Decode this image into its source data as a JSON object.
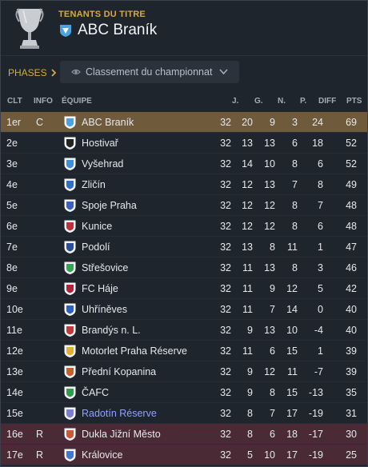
{
  "title_holder": {
    "label": "TENANTS DU TITRE",
    "team": "ABC Braník"
  },
  "toolbar": {
    "phases_label": "PHASES",
    "dropdown_value": "Classement du championnat"
  },
  "table": {
    "headers": {
      "pos": "CLT",
      "info": "INFO",
      "team": "ÉQUIPE",
      "played": "J.",
      "won": "G.",
      "drawn": "N.",
      "lost": "P.",
      "diff": "DIFF",
      "pts": "PTS"
    },
    "rows": [
      {
        "pos": "1er",
        "info": "C",
        "team": "ABC Braník",
        "played": "32",
        "won": "20",
        "drawn": "9",
        "lost": "3",
        "diff": "24",
        "pts": "69",
        "crest_color": "#4aa3e0",
        "status": "champion"
      },
      {
        "pos": "2e",
        "info": "",
        "team": "Hostivař",
        "played": "32",
        "won": "13",
        "drawn": "13",
        "lost": "6",
        "diff": "18",
        "pts": "52",
        "crest_color": "#222222",
        "status": ""
      },
      {
        "pos": "3e",
        "info": "",
        "team": "Vyšehrad",
        "played": "32",
        "won": "14",
        "drawn": "10",
        "lost": "8",
        "diff": "6",
        "pts": "52",
        "crest_color": "#3c8fd8",
        "status": ""
      },
      {
        "pos": "4e",
        "info": "",
        "team": "Zličín",
        "played": "32",
        "won": "12",
        "drawn": "13",
        "lost": "7",
        "diff": "8",
        "pts": "49",
        "crest_color": "#2d6fd0",
        "status": ""
      },
      {
        "pos": "5e",
        "info": "",
        "team": "Spoje Praha",
        "played": "32",
        "won": "12",
        "drawn": "12",
        "lost": "8",
        "diff": "7",
        "pts": "48",
        "crest_color": "#3b5fc4",
        "status": ""
      },
      {
        "pos": "6e",
        "info": "",
        "team": "Kunice",
        "played": "32",
        "won": "12",
        "drawn": "12",
        "lost": "8",
        "diff": "6",
        "pts": "48",
        "crest_color": "#c2303a",
        "status": ""
      },
      {
        "pos": "7e",
        "info": "",
        "team": "Podolí",
        "played": "32",
        "won": "13",
        "drawn": "8",
        "lost": "11",
        "diff": "1",
        "pts": "47",
        "crest_color": "#2a4f9c",
        "status": ""
      },
      {
        "pos": "8e",
        "info": "",
        "team": "Střešovice",
        "played": "32",
        "won": "11",
        "drawn": "13",
        "lost": "8",
        "diff": "3",
        "pts": "46",
        "crest_color": "#2fa84f",
        "status": ""
      },
      {
        "pos": "9e",
        "info": "",
        "team": "FC Háje",
        "played": "32",
        "won": "11",
        "drawn": "9",
        "lost": "12",
        "diff": "5",
        "pts": "42",
        "crest_color": "#b0243a",
        "status": ""
      },
      {
        "pos": "10e",
        "info": "",
        "team": "Uhříněves",
        "played": "32",
        "won": "11",
        "drawn": "7",
        "lost": "14",
        "diff": "0",
        "pts": "40",
        "crest_color": "#2c62c4",
        "status": ""
      },
      {
        "pos": "11e",
        "info": "",
        "team": "Brandýs n. L.",
        "played": "32",
        "won": "9",
        "drawn": "13",
        "lost": "10",
        "diff": "-4",
        "pts": "40",
        "crest_color": "#c23a3a",
        "status": ""
      },
      {
        "pos": "12e",
        "info": "",
        "team": "Motorlet Praha Réserve",
        "played": "32",
        "won": "11",
        "drawn": "6",
        "lost": "15",
        "diff": "1",
        "pts": "39",
        "crest_color": "#e0b12a",
        "status": ""
      },
      {
        "pos": "13e",
        "info": "",
        "team": "Přední Kopanina",
        "played": "32",
        "won": "9",
        "drawn": "12",
        "lost": "11",
        "diff": "-7",
        "pts": "39",
        "crest_color": "#c8602a",
        "status": ""
      },
      {
        "pos": "14e",
        "info": "",
        "team": "ČAFC",
        "played": "32",
        "won": "9",
        "drawn": "8",
        "lost": "15",
        "diff": "-13",
        "pts": "35",
        "crest_color": "#2f9e4a",
        "status": ""
      },
      {
        "pos": "15e",
        "info": "",
        "team": "Radotín Réserve",
        "played": "32",
        "won": "8",
        "drawn": "7",
        "lost": "17",
        "diff": "-19",
        "pts": "31",
        "crest_color": "#7a7fd0",
        "status": "reserve"
      },
      {
        "pos": "16e",
        "info": "R",
        "team": "Dukla Jižní Město",
        "played": "32",
        "won": "8",
        "drawn": "6",
        "lost": "18",
        "diff": "-17",
        "pts": "30",
        "crest_color": "#d4552f",
        "status": "relegated"
      },
      {
        "pos": "17e",
        "info": "R",
        "team": "Královice",
        "played": "32",
        "won": "5",
        "drawn": "10",
        "lost": "17",
        "diff": "-19",
        "pts": "25",
        "crest_color": "#3e78d0",
        "status": "relegated"
      }
    ]
  },
  "colors": {
    "accent": "#d7a93f",
    "champion_row": "#6f5b3b",
    "relegation_row": "#4a2b35",
    "reserve_link": "#8ea2ff"
  },
  "icons": {
    "trophy": "trophy-icon",
    "phases_arrow": "chevron-right-icon",
    "dropdown_eye": "eye-icon",
    "dropdown_caret": "chevron-down-icon"
  }
}
